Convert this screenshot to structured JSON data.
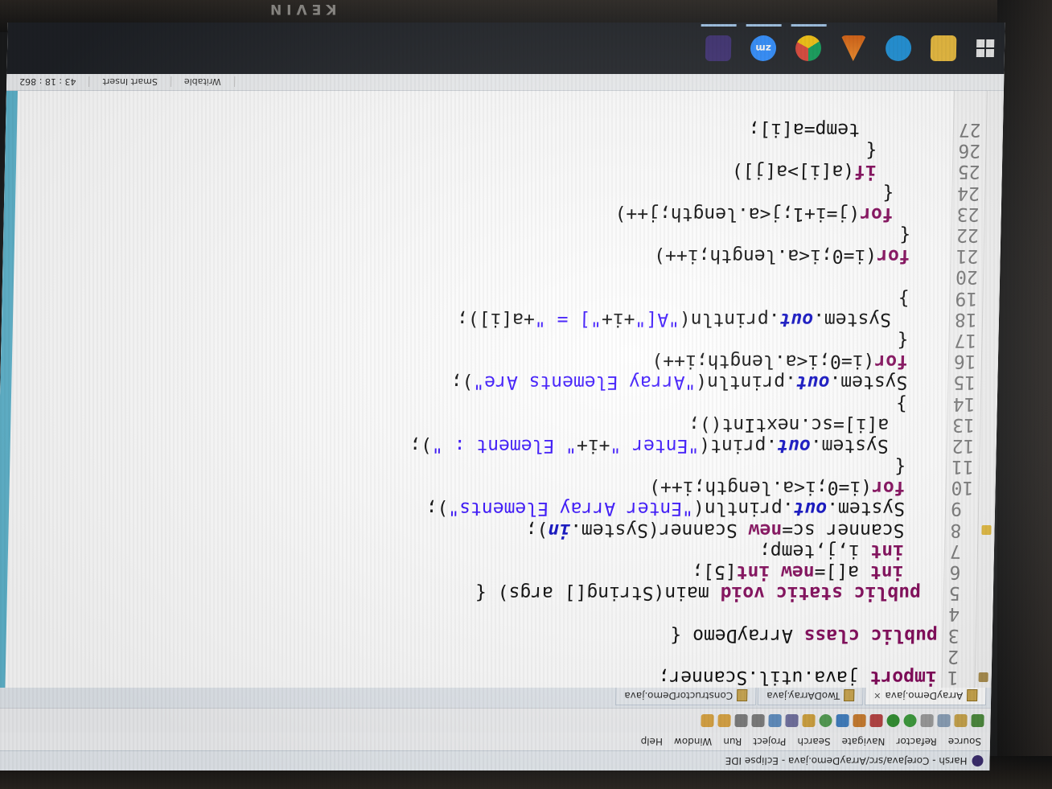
{
  "monitor": {
    "brand": "KEVIN"
  },
  "window": {
    "title": "Harsh - CoreJava/src/ArrayDemo.java - Eclipse IDE",
    "menus": [
      "Source",
      "Refactor",
      "Navigate",
      "Search",
      "Project",
      "Run",
      "Window",
      "Help"
    ]
  },
  "tabs": [
    {
      "label": "ArrayDemo.java",
      "close": "✕",
      "active": true
    },
    {
      "label": "TwoDArray.java",
      "close": "",
      "active": false
    },
    {
      "label": "ConstructorDemo.java",
      "close": "",
      "active": false
    }
  ],
  "code_lines": [
    {
      "n": "1",
      "t": "import java.util.Scanner;"
    },
    {
      "n": "2",
      "t": ""
    },
    {
      "n": "3",
      "t": "public class ArrayDemo {"
    },
    {
      "n": "4",
      "t": ""
    },
    {
      "n": "5",
      "t": "public static void main(String[] args) {"
    },
    {
      "n": "6",
      "t": "int a[]=new int[5];"
    },
    {
      "n": "7",
      "t": "int i,j,temp;"
    },
    {
      "n": "8",
      "t": "Scanner sc=new Scanner(System.in);"
    },
    {
      "n": "9",
      "t": "System.out.println(\"Enter Array Elements\");"
    },
    {
      "n": "10",
      "t": "for(i=0;i<a.length;i++)"
    },
    {
      "n": "11",
      "t": "{"
    },
    {
      "n": "12",
      "t": "System.out.print(\"Enter \"+i+\" Element : \");"
    },
    {
      "n": "13",
      "t": "a[i]=sc.nextInt();"
    },
    {
      "n": "14",
      "t": "}"
    },
    {
      "n": "15",
      "t": "System.out.println(\"Array Elements Are\");"
    },
    {
      "n": "16",
      "t": "for(i=0;i<a.length;i++)"
    },
    {
      "n": "17",
      "t": "{"
    },
    {
      "n": "18",
      "t": "System.out.println(\"A[\"+i+\"] = \"+a[i]);"
    },
    {
      "n": "19",
      "t": "}"
    },
    {
      "n": "20",
      "t": ""
    },
    {
      "n": "21",
      "t": "for(i=0;i<a.length;i++)"
    },
    {
      "n": "22",
      "t": "{"
    },
    {
      "n": "23",
      "t": "for(j=i+1;j<a.length;j++)"
    },
    {
      "n": "24",
      "t": "{"
    },
    {
      "n": "25",
      "t": "if(a[i]>a[j])"
    },
    {
      "n": "26",
      "t": "{"
    },
    {
      "n": "27",
      "t": "temp=a[i];"
    }
  ],
  "status": {
    "writable": "Writable",
    "insert": "Smart Insert",
    "position": "43 : 18 : 862"
  },
  "taskbar": {
    "icons": [
      "windows-start-icon",
      "file-explorer-icon",
      "edge-icon",
      "vlc-icon",
      "chrome-icon",
      "zoom-icon",
      "eclipse-icon"
    ],
    "zoom_label": "zm"
  }
}
